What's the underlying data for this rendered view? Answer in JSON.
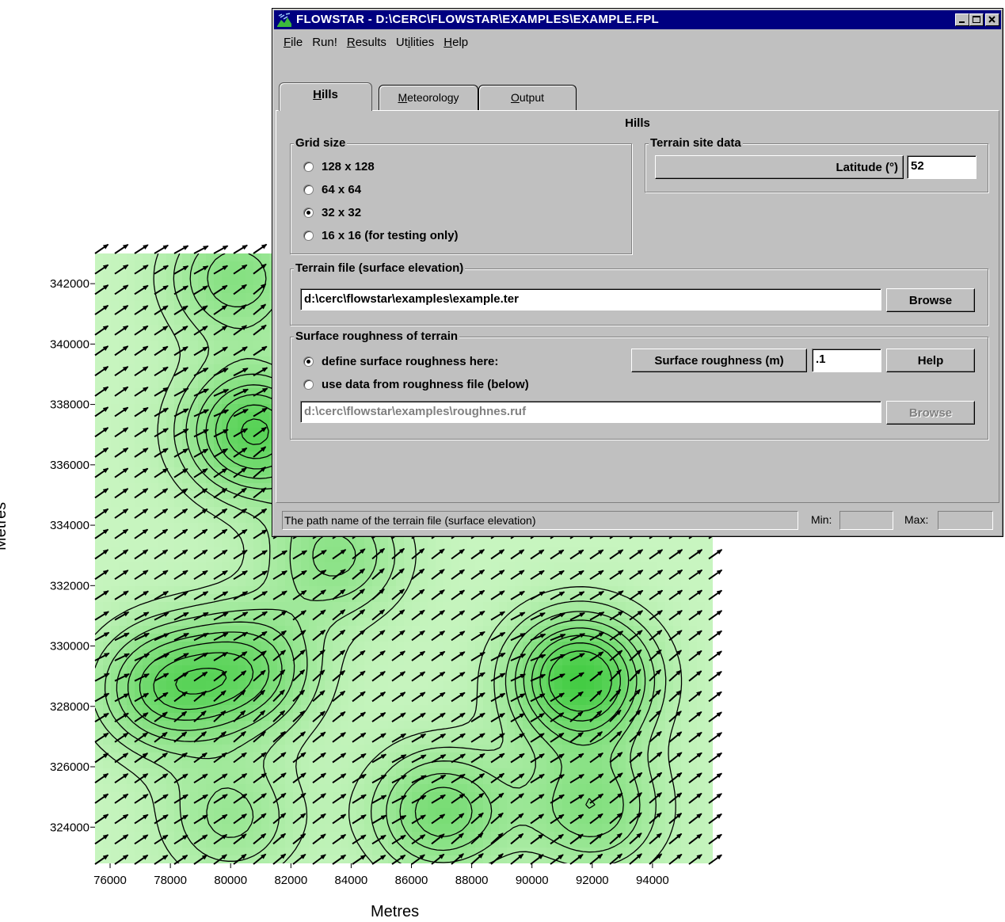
{
  "window": {
    "title": "FLOWSTAR - D:\\CERC\\FLOWSTAR\\EXAMPLES\\EXAMPLE.FPL",
    "icon": "flowstar-app-icon",
    "controls": [
      "minimize-icon",
      "maximize-icon",
      "close-icon"
    ]
  },
  "menu": [
    {
      "mn": "F",
      "rest": "ile"
    },
    {
      "mn": "",
      "rest": "Run!"
    },
    {
      "mn": "R",
      "rest": "esults"
    },
    {
      "pre": "Ut",
      "mn": "i",
      "rest": "lities"
    },
    {
      "mn": "H",
      "rest": "elp"
    }
  ],
  "menu_text": {
    "file_mn": "F",
    "file_rest": "ile",
    "run": "Run!",
    "results_mn": "R",
    "results_rest": "esults",
    "util_pre": "Ut",
    "util_mn": "i",
    "util_rest": "lities",
    "help_mn": "H",
    "help_rest": "elp"
  },
  "tabs": {
    "hills_mn": "H",
    "hills_rest": "ills",
    "met_mn": "M",
    "met_rest": "eteorology",
    "out_mn": "O",
    "out_rest": "utput",
    "active": "Hills"
  },
  "panel_title": "Hills",
  "grid_size": {
    "legend": "Grid size",
    "options": [
      "128 x 128",
      "64 x 64",
      "32 x 32",
      "16 x 16  (for testing only)"
    ],
    "selected": "32 x 32"
  },
  "terrain_site": {
    "legend": "Terrain site data",
    "latitude_label": "Latitude (°)",
    "latitude_value": "52"
  },
  "terrain_file": {
    "legend": "Terrain file (surface elevation)",
    "path": "d:\\cerc\\flowstar\\examples\\example.ter",
    "browse": "Browse"
  },
  "roughness": {
    "legend": "Surface roughness of terrain",
    "option_here": "define surface roughness here:",
    "option_file": "use data from roughness file (below)",
    "selected": "define surface roughness here:",
    "label": "Surface roughness (m)",
    "value": ".1",
    "help": "Help",
    "file_path": "d:\\cerc\\flowstar\\examples\\roughnes.ruf",
    "browse": "Browse"
  },
  "status": {
    "message": "The path name of the terrain file (surface elevation)",
    "min_label": "Min:",
    "min_value": "",
    "max_label": "Max:",
    "max_value": ""
  },
  "plot": {
    "xlabel": "Metres",
    "ylabel": "Metres",
    "xticks": [
      "76000",
      "78000",
      "80000",
      "82000",
      "84000",
      "86000",
      "88000",
      "90000",
      "92000",
      "94000"
    ],
    "yticks": [
      "324000",
      "326000",
      "328000",
      "330000",
      "332000",
      "334000",
      "336000",
      "338000",
      "340000",
      "342000"
    ],
    "xlim": [
      75500,
      96000
    ],
    "ylim": [
      322800,
      343000
    ],
    "fill_colors": {
      "low": "#c8f5c0",
      "high": "#44cc44"
    },
    "contour_color": "#000000",
    "arrow_color": "#000000",
    "hills": [
      {
        "x": 80800,
        "y": 337100,
        "h": 0.85
      },
      {
        "x": 91600,
        "y": 328900,
        "h": 1.0
      },
      {
        "x": 77800,
        "y": 328600,
        "h": 0.65
      },
      {
        "x": 80600,
        "y": 329200,
        "h": 0.6
      },
      {
        "x": 87000,
        "y": 324500,
        "h": 0.6
      },
      {
        "x": 92000,
        "y": 324600,
        "h": 0.5
      },
      {
        "x": 80200,
        "y": 342200,
        "h": 0.5
      },
      {
        "x": 83500,
        "y": 333000,
        "h": 0.45
      },
      {
        "x": 80000,
        "y": 324300,
        "h": 0.35
      }
    ]
  }
}
